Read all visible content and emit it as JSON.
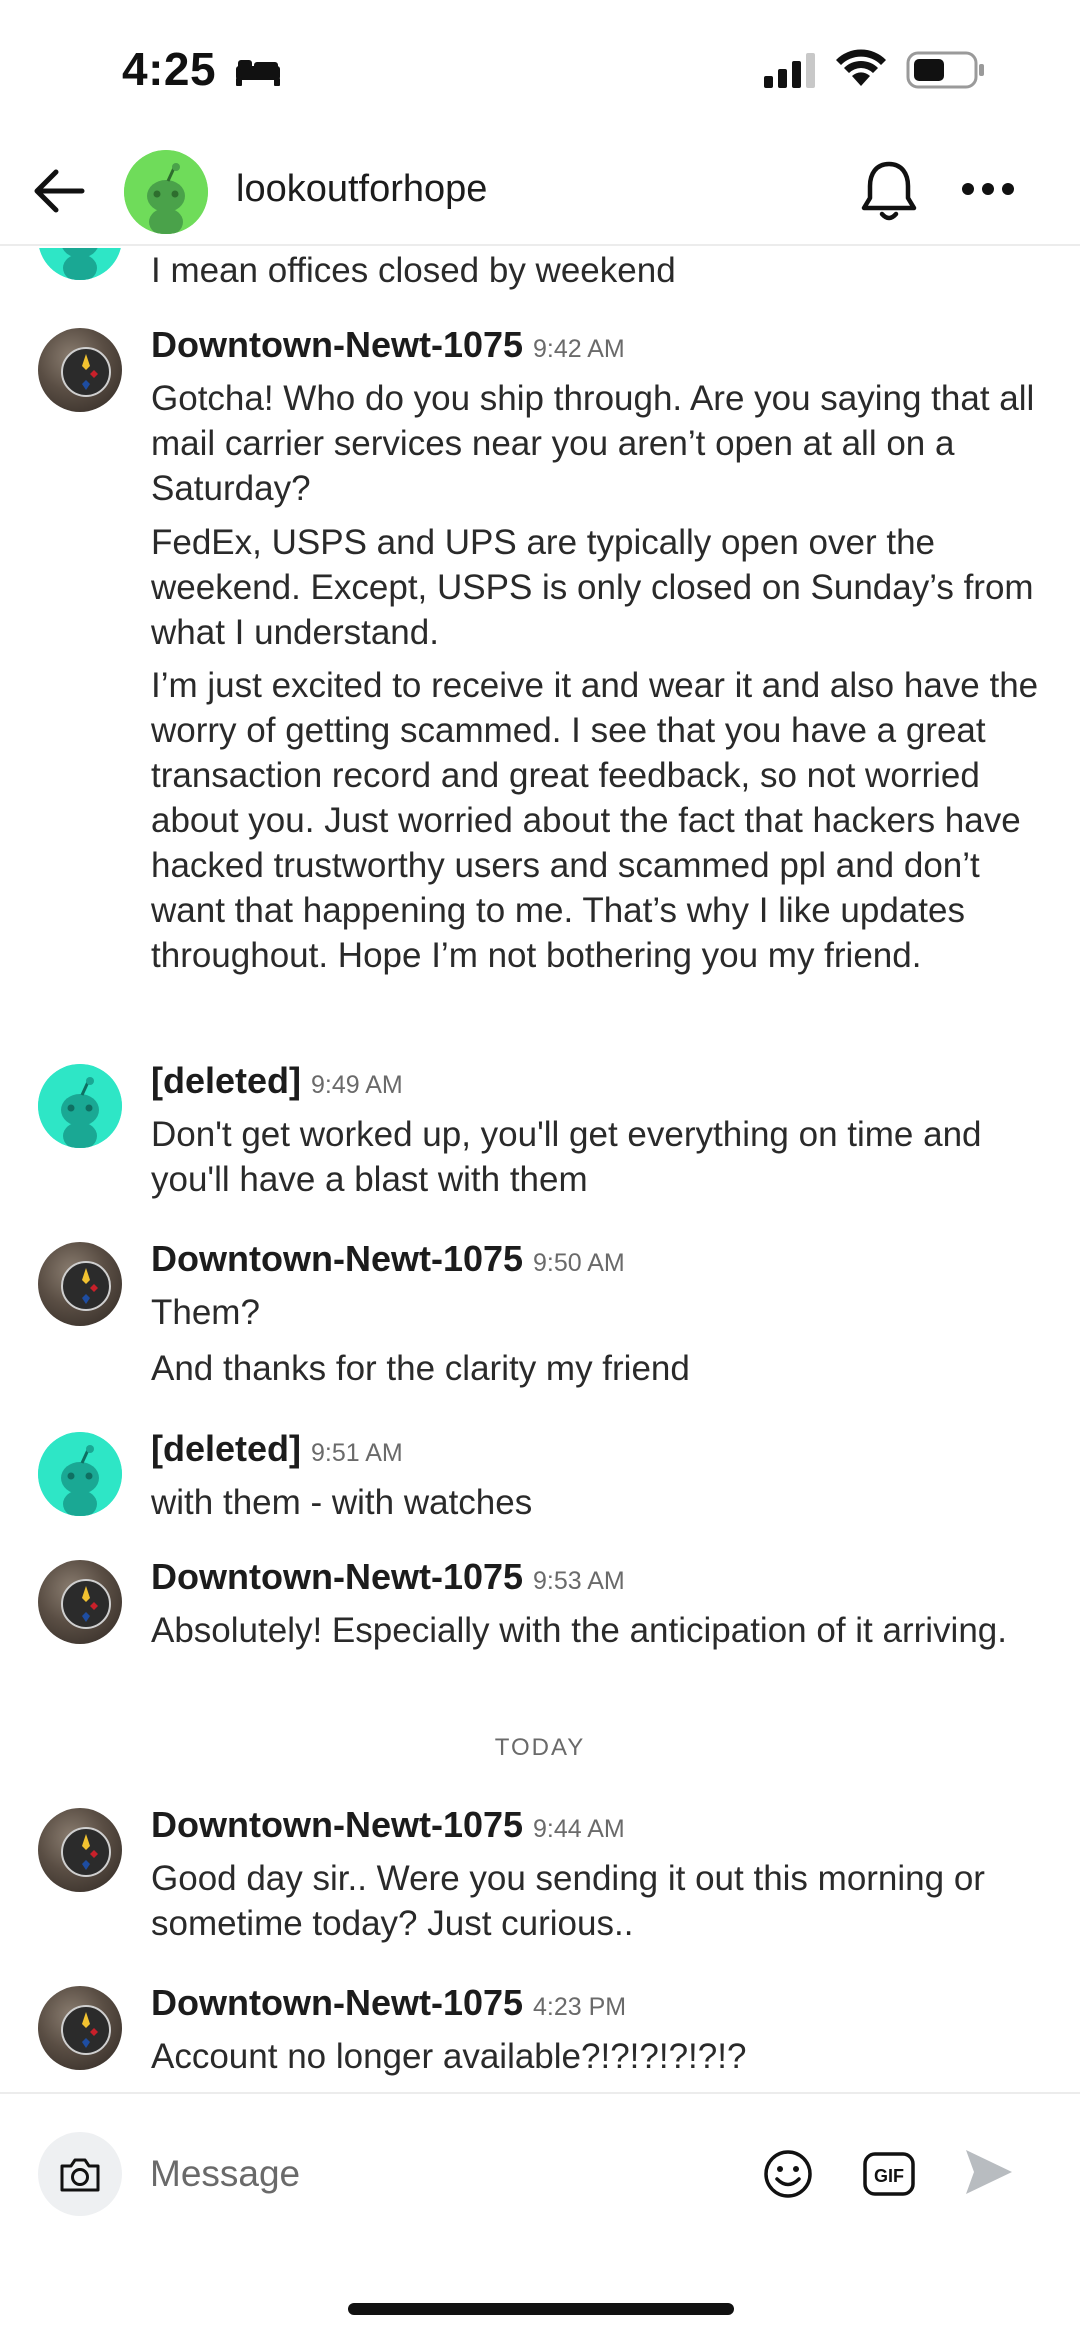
{
  "status_bar": {
    "time": "4:25"
  },
  "header": {
    "title": "lookoutforhope"
  },
  "messages": [
    {
      "author": "",
      "time": "",
      "avatar": "deleted",
      "lines": [
        "I mean offices closed by weekend"
      ]
    },
    {
      "author": "Downtown-Newt-1075",
      "time": "9:42 AM",
      "avatar": "newt",
      "paragraphs": [
        "Gotcha!  Who do you ship through.  Are you saying that all mail carrier services near you aren’t open at all on a Saturday?",
        "FedEx, USPS and UPS are typically open over the weekend.  Except, USPS is only closed on Sunday’s from what I understand.",
        "I’m just excited to receive it and wear it and also have the worry of getting scammed.  I see that you have a great transaction record and great feedback, so not worried about you.  Just worried about the fact that hackers have hacked trustworthy users and scammed ppl and don’t want that happening to me.  That’s why I like updates throughout.  Hope I’m not bothering you my friend."
      ]
    },
    {
      "author": "[deleted]",
      "time": "9:49 AM",
      "avatar": "deleted",
      "paragraphs": [
        "Don't get worked up, you'll get everything on time and you'll have a blast with them"
      ]
    },
    {
      "author": "Downtown-Newt-1075",
      "time": "9:50 AM",
      "avatar": "newt",
      "paragraphs": [
        "Them?",
        "And thanks for the clarity my friend"
      ]
    },
    {
      "author": "[deleted]",
      "time": "9:51 AM",
      "avatar": "deleted",
      "paragraphs": [
        "with them - with watches"
      ]
    },
    {
      "author": "Downtown-Newt-1075",
      "time": "9:53 AM",
      "avatar": "newt",
      "paragraphs": [
        "Absolutely!  Especially with the anticipation of it arriving."
      ]
    },
    {
      "author": "Downtown-Newt-1075",
      "time": "9:44 AM",
      "avatar": "newt",
      "paragraphs": [
        "Good day sir..  Were you sending it out this morning or sometime today?  Just curious.."
      ]
    },
    {
      "author": "Downtown-Newt-1075",
      "time": "4:23 PM",
      "avatar": "newt",
      "paragraphs": [
        "Account no longer available?!?!?!?!?!?"
      ]
    }
  ],
  "date_divider": "TODAY",
  "composer": {
    "placeholder": "Message",
    "gif_label": "GIF"
  },
  "colors": {
    "deleted_avatar": "#2ee6c6",
    "header_avatar": "#6fdc5a",
    "send_disabled": "#b8bcc0"
  }
}
